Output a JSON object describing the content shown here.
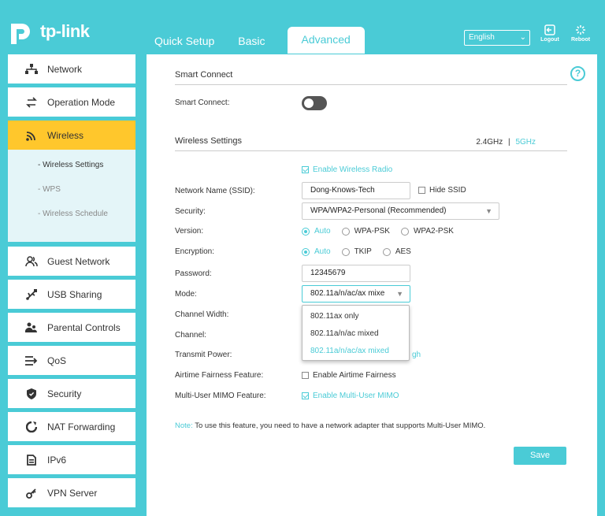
{
  "header": {
    "brand": "tp-link",
    "tabs": [
      "Quick Setup",
      "Basic",
      "Advanced"
    ],
    "language": "English",
    "logout_label": "Logout",
    "reboot_label": "Reboot"
  },
  "sidebar": {
    "items": [
      {
        "label": "Network",
        "icon": "network-icon"
      },
      {
        "label": "Operation Mode",
        "icon": "operation-mode-icon"
      },
      {
        "label": "Wireless",
        "icon": "wifi-icon"
      },
      {
        "label": "Guest Network",
        "icon": "guests-icon"
      },
      {
        "label": "USB Sharing",
        "icon": "usb-icon"
      },
      {
        "label": "Parental Controls",
        "icon": "parental-icon"
      },
      {
        "label": "QoS",
        "icon": "qos-icon"
      },
      {
        "label": "Security",
        "icon": "shield-icon"
      },
      {
        "label": "NAT Forwarding",
        "icon": "nat-icon"
      },
      {
        "label": "IPv6",
        "icon": "ipv6-icon"
      },
      {
        "label": "VPN Server",
        "icon": "key-icon"
      }
    ],
    "wireless_sub": [
      "- Wireless Settings",
      "- WPS",
      "- Wireless Schedule"
    ]
  },
  "smart_connect": {
    "title": "Smart Connect",
    "label": "Smart Connect:",
    "enabled": false
  },
  "wireless": {
    "title": "Wireless Settings",
    "band_24": "2.4GHz",
    "band_sep": "|",
    "band_5": "5GHz",
    "enable_radio": "Enable Wireless Radio",
    "ssid_label": "Network Name (SSID):",
    "ssid_value": "Dong-Knows-Tech",
    "hide_ssid": "Hide SSID",
    "security_label": "Security:",
    "security_value": "WPA/WPA2-Personal (Recommended)",
    "version_label": "Version:",
    "version_options": [
      "Auto",
      "WPA-PSK",
      "WPA2-PSK"
    ],
    "encryption_label": "Encryption:",
    "encryption_options": [
      "Auto",
      "TKIP",
      "AES"
    ],
    "password_label": "Password:",
    "password_value": "12345679",
    "mode_label": "Mode:",
    "mode_value": "802.11a/n/ac/ax mixe",
    "mode_options": [
      "802.11ax only",
      "802.11a/n/ac mixed",
      "802.11a/n/ac/ax mixed"
    ],
    "channel_width_label": "Channel Width:",
    "channel_label": "Channel:",
    "transmit_power_label": "Transmit Power:",
    "transmit_power_peek": "gh",
    "airtime_label": "Airtime Fairness Feature:",
    "airtime_option": "Enable Airtime Fairness",
    "mumimo_label": "Multi-User MIMO Feature:",
    "mumimo_option": "Enable Multi-User MIMO",
    "note_label": "Note:",
    "note_text": "To use this feature, you need to have a network adapter that supports Multi-User MIMO.",
    "save_label": "Save"
  },
  "colors": {
    "accent": "#4acbd6",
    "active_nav": "#ffc72c"
  }
}
